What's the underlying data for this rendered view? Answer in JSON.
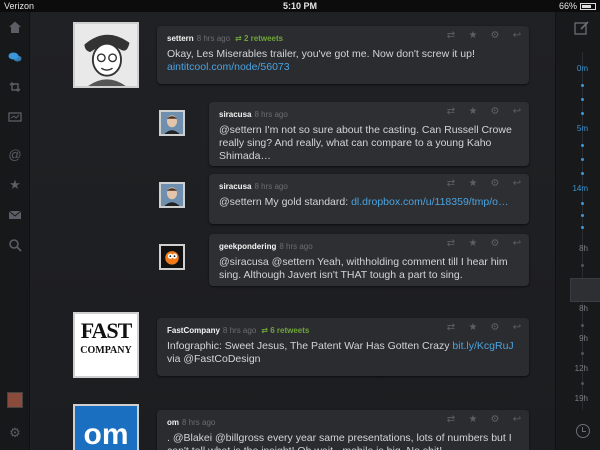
{
  "status": {
    "carrier": "Verizon",
    "time": "5:10 PM",
    "battery": "66%"
  },
  "sidebar": {
    "items": [
      {
        "icon": "home-icon"
      },
      {
        "icon": "chat-bubbles-icon",
        "active": true
      },
      {
        "icon": "retweet-icon"
      },
      {
        "icon": "list-icon"
      },
      {
        "icon": "at-mention-icon"
      },
      {
        "icon": "star-icon"
      },
      {
        "icon": "envelope-icon"
      },
      {
        "icon": "search-icon"
      }
    ]
  },
  "scrubber": {
    "labels": [
      "0m",
      "5m",
      "14m",
      "8h",
      "8h",
      "9h",
      "12h",
      "19h"
    ]
  },
  "tweets": [
    {
      "user": "settern",
      "time": "8 hrs ago",
      "retweets": "2 retweets",
      "text": "Okay, Les Miserables trailer, you've got me. Now don't screw it up!",
      "link": "aintitcool.com/node/56073"
    },
    {
      "user": "siracusa",
      "time": "8 hrs ago",
      "text": "@settern I'm not so sure about the casting. Can Russell Crowe really sing?  And really, what can compare to a young Kaho Shimada…"
    },
    {
      "user": "siracusa",
      "time": "8 hrs ago",
      "text": "@settern My gold standard:",
      "link": "dl.dropbox.com/u/118359/tmp/o…"
    },
    {
      "user": "geekpondering",
      "time": "8 hrs ago",
      "text": "@siracusa @settern Yeah, withholding comment till I hear him sing. Although Javert isn't THAT tough a part to sing."
    },
    {
      "user": "FastCompany",
      "time": "8 hrs ago",
      "retweets": "6 retweets",
      "text": "Infographic: Sweet Jesus, The Patent War Has Gotten Crazy",
      "link": "bit.ly/KcgRuJ",
      "via": "via @FastCoDesign",
      "avatar_text_1": "FAST",
      "avatar_text_2": "COMPANY"
    },
    {
      "user": "om",
      "time": "8 hrs ago",
      "text": ". @Blakei @billgross every year same presentations, lots of numbers but I can't tell what is the insight! Oh wait - mobile is big. No shit!",
      "avatar_text": "om"
    }
  ],
  "colors": {
    "accent": "#3b97d9",
    "retweet": "#6fa53b",
    "link": "#4aa3e0"
  }
}
